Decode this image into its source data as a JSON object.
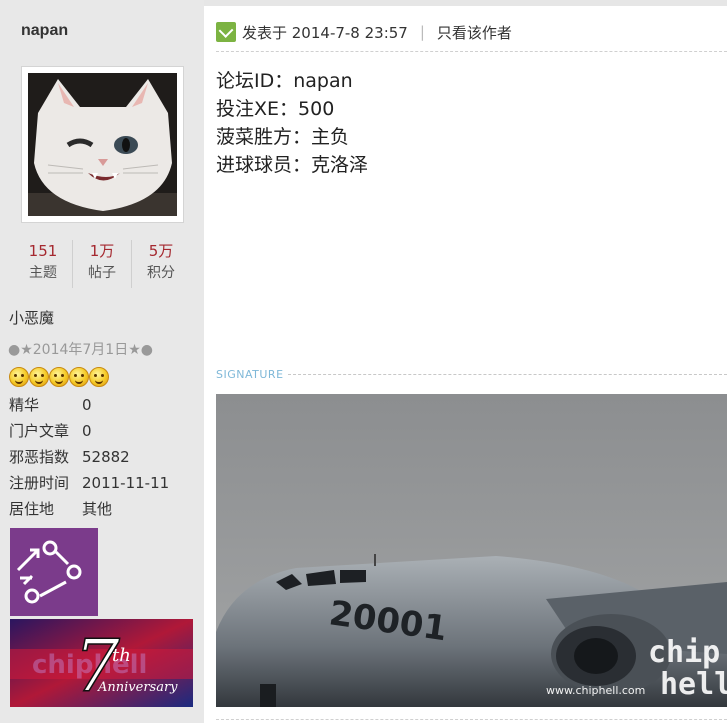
{
  "user": {
    "name": "napan",
    "stats": [
      {
        "value": "151",
        "label": "主题"
      },
      {
        "value": "1万",
        "label": "帖子"
      },
      {
        "value": "5万",
        "label": "积分"
      }
    ],
    "rank": "小恶魔",
    "rank_sub": "●★2014年7月1日★●",
    "info": [
      {
        "key": "精华",
        "value": "0"
      },
      {
        "key": "门户文章",
        "value": "0"
      },
      {
        "key": "邪恶指数",
        "value": "52882"
      },
      {
        "key": "注册时间",
        "value": "2011-11-11"
      },
      {
        "key": "居住地",
        "value": "其他"
      }
    ],
    "badge2": {
      "big": "7",
      "sup": "th",
      "word": "Anniversary"
    }
  },
  "post": {
    "posted_label": "发表于 2014-7-8 23:57",
    "author_only": "只看该作者",
    "lines": [
      "论坛ID：napan",
      "投注XE：500",
      "菠菜胜方：主负",
      "进球球员：克洛泽"
    ]
  },
  "signature": {
    "label": "SIGNATURE",
    "plane_number": "20001",
    "watermark": "www.chiphell.com",
    "logo_top": "chip",
    "logo_bottom": "hell"
  },
  "colors": {
    "stat_value": "#a5282f",
    "sidebar_bg": "#e8e8e8"
  }
}
